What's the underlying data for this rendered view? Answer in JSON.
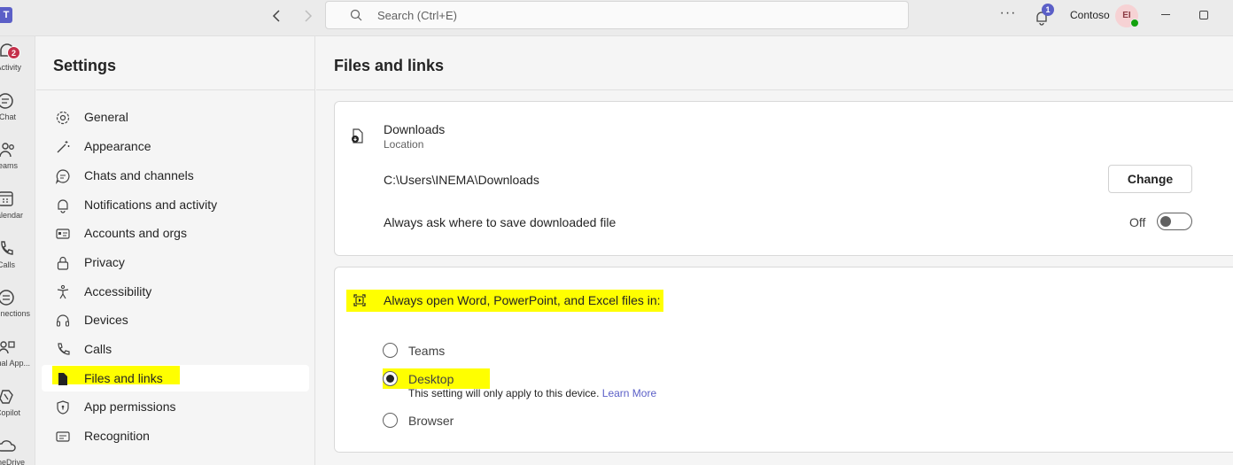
{
  "titlebar": {
    "app_logo_letter": "T",
    "search_placeholder": "Search (Ctrl+E)",
    "more_label": "···",
    "notification_badge": "1",
    "org_name": "Contoso",
    "avatar_initials": "EI"
  },
  "rail": {
    "items": [
      {
        "label": "Activity",
        "icon": "bell-icon",
        "badge": "2"
      },
      {
        "label": "Chat",
        "icon": "chat-icon"
      },
      {
        "label": "Teams",
        "icon": "teams-icon"
      },
      {
        "label": "Calendar",
        "icon": "calendar-icon"
      },
      {
        "label": "Calls",
        "icon": "phone-icon"
      },
      {
        "label": "Connections",
        "icon": "connections-icon"
      },
      {
        "label": "Personal App...",
        "icon": "apps-icon"
      },
      {
        "label": "Copilot",
        "icon": "copilot-icon"
      },
      {
        "label": "OneDrive",
        "icon": "cloud-icon"
      }
    ]
  },
  "settings": {
    "title": "Settings",
    "items": [
      {
        "label": "General",
        "icon": "gear-icon"
      },
      {
        "label": "Appearance",
        "icon": "wand-icon"
      },
      {
        "label": "Chats and channels",
        "icon": "chat-bubble-icon"
      },
      {
        "label": "Notifications and activity",
        "icon": "bell-icon"
      },
      {
        "label": "Accounts and orgs",
        "icon": "id-card-icon"
      },
      {
        "label": "Privacy",
        "icon": "lock-icon"
      },
      {
        "label": "Accessibility",
        "icon": "accessibility-icon"
      },
      {
        "label": "Devices",
        "icon": "headset-icon"
      },
      {
        "label": "Calls",
        "icon": "phone-icon"
      },
      {
        "label": "Files and links",
        "icon": "document-icon",
        "selected": true
      },
      {
        "label": "App permissions",
        "icon": "shield-icon"
      },
      {
        "label": "Recognition",
        "icon": "recognition-icon"
      }
    ]
  },
  "main": {
    "title": "Files and links",
    "downloads": {
      "title": "Downloads",
      "subtitle": "Location",
      "path": "C:\\Users\\INEMA\\Downloads",
      "change_label": "Change",
      "ask_label": "Always ask where to save downloaded file",
      "toggle_state": "Off",
      "toggle_on": false
    },
    "open_files": {
      "label": "Always open Word, PowerPoint, and Excel files in:",
      "options": [
        {
          "label": "Teams",
          "checked": false
        },
        {
          "label": "Desktop",
          "checked": true
        },
        {
          "label": "Browser",
          "checked": false
        }
      ],
      "desktop_note": "This setting will only apply to this device.",
      "learn_more": "Learn More"
    }
  },
  "colors": {
    "accent": "#5b5fc7",
    "highlight": "#ffff00",
    "badge_red": "#c4314b",
    "status_green": "#13a10e"
  }
}
